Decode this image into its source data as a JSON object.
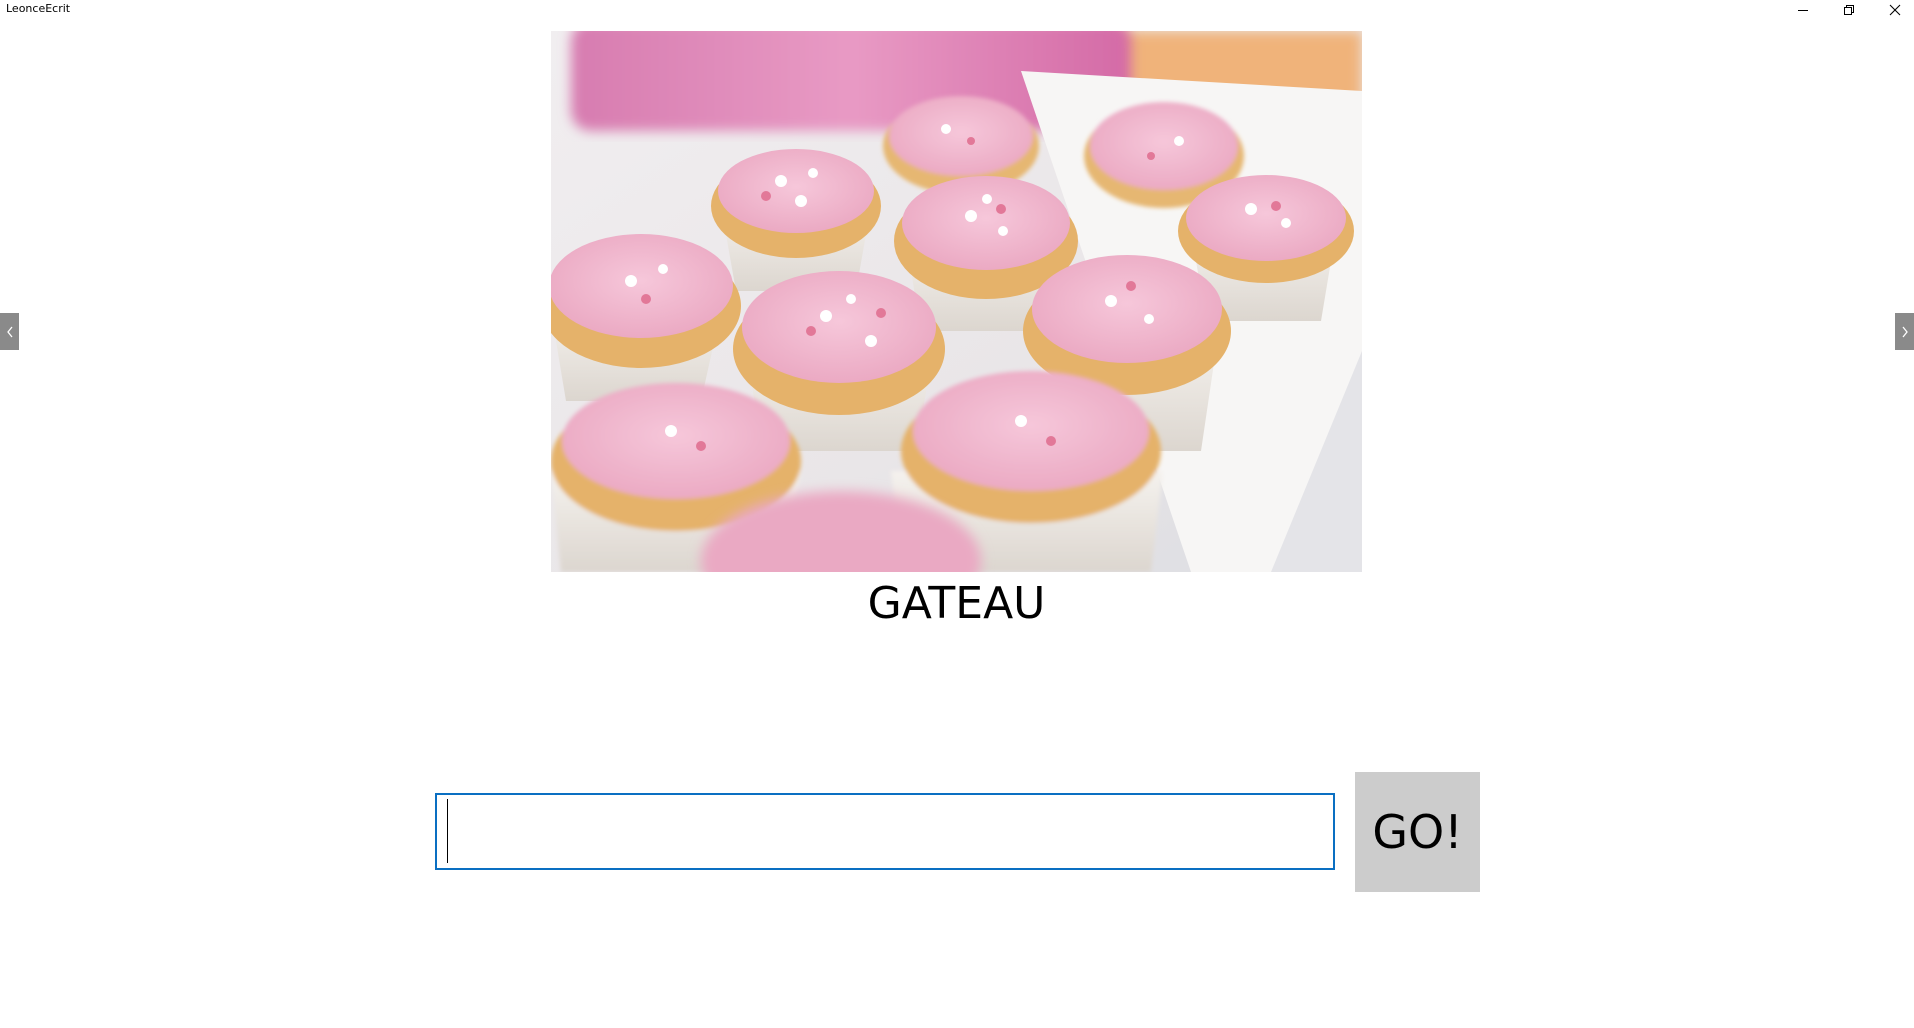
{
  "window": {
    "title": "LeonceEcrit",
    "controls": {
      "minimize_icon": "minimize-icon",
      "restore_icon": "restore-icon",
      "close_icon": "close-icon"
    }
  },
  "main": {
    "image_subject_icon": "cupcakes-photo",
    "word": "GATEAU",
    "answer_value": "",
    "go_label": "GO!"
  },
  "navigation": {
    "previous_icon": "chevron-left-icon",
    "next_icon": "chevron-right-icon"
  },
  "colors": {
    "accent_border": "#0a6fc2",
    "go_button_bg": "#cccccc",
    "nav_arrow_bg": "#8a8a8a"
  }
}
